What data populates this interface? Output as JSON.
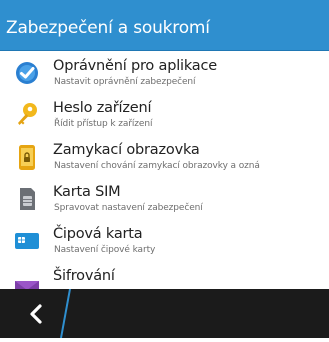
{
  "header": {
    "title": "Zabezpečení a soukromí"
  },
  "items": [
    {
      "title": "Oprávnění pro aplikace",
      "subtitle": "Nastavit oprávnění zabezpečení",
      "icon": "shield-check-icon"
    },
    {
      "title": "Heslo zařízení",
      "subtitle": "Řídit přístup k zařízení",
      "icon": "key-icon"
    },
    {
      "title": "Zamykací obrazovka",
      "subtitle": "Nastavení chování zamykací obrazovky a ozná",
      "icon": "lock-screen-icon"
    },
    {
      "title": "Karta SIM",
      "subtitle": "Spravovat nastavení zabezpečení",
      "icon": "sim-card-icon"
    },
    {
      "title": "Čipová karta",
      "subtitle": "Nastavení čipové karty",
      "icon": "smart-card-icon"
    },
    {
      "title": "Šifrování",
      "subtitle": "",
      "icon": "envelope-icon"
    }
  ],
  "colors": {
    "header": "#2f8fcf",
    "bottom_bar": "#1b1b1b",
    "accent": "#2f8fcf"
  },
  "bottom_bar": {
    "back_icon": "back-icon"
  }
}
